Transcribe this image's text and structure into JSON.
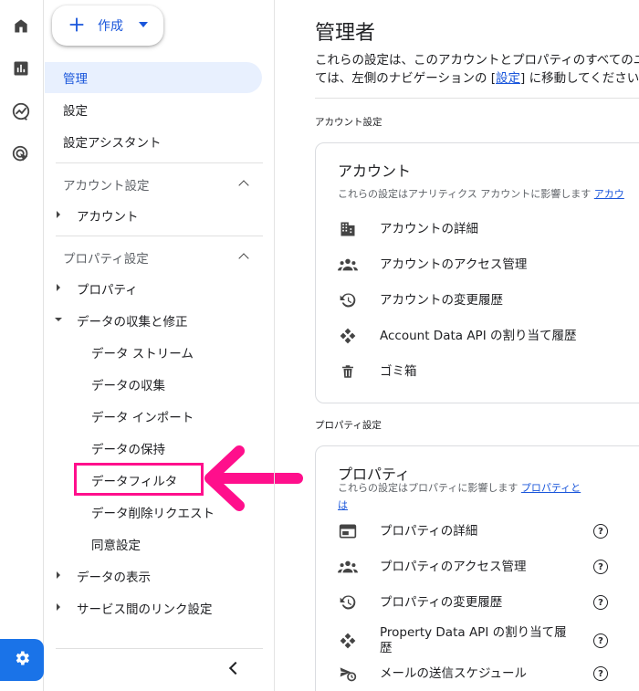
{
  "rail": {
    "icons": [
      "home-icon",
      "bar-chart-icon",
      "explore-icon",
      "advertising-icon"
    ],
    "settings_icon": "gear-icon",
    "accent": "#1a73e8"
  },
  "create_button": {
    "label": "作成"
  },
  "sidebar": {
    "admin": "管理",
    "settings": "設定",
    "setup_assistant": "設定アシスタント",
    "account_section": "アカウント設定",
    "account": "アカウント",
    "property_section": "プロパティ設定",
    "property": "プロパティ",
    "data_collection_group": "データの収集と修正",
    "sub_items": [
      "データ ストリーム",
      "データの収集",
      "データ インポート",
      "データの保持",
      "データフィルタ",
      "データ削除リクエスト",
      "同意設定"
    ],
    "data_display": "データの表示",
    "service_links": "サービス間のリンク設定",
    "highlight_color": "#ff0f8c"
  },
  "main": {
    "title": "管理者",
    "desc_line1": "これらの設定は、このアカウントとプロパティのすべてのユ",
    "desc_line2_pre": "ては、左側のナビゲーションの [",
    "desc_link": "設定",
    "desc_line2_post": "] に移動してください。",
    "account_label": "アカウント設定",
    "account_card": {
      "title": "アカウント",
      "subtitle": "これらの設定はアナリティクス アカウントに影響します",
      "subtitle_link": "アカウ",
      "rows": [
        {
          "icon": "building-icon",
          "label": "アカウントの詳細"
        },
        {
          "icon": "people-icon",
          "label": "アカウントのアクセス管理"
        },
        {
          "icon": "history-icon",
          "label": "アカウントの変更履歴"
        },
        {
          "icon": "api-icon",
          "label": "Account Data API の割り当て履歴"
        },
        {
          "icon": "trash-icon",
          "label": "ゴミ箱"
        }
      ]
    },
    "property_label": "プロパティ設定",
    "property_card": {
      "title": "プロパティ",
      "subtitle": "これらの設定はプロパティに影響します",
      "subtitle_link1": "プロパティと",
      "subtitle_link2": "は",
      "rows": [
        {
          "icon": "web-icon",
          "label": "プロパティの詳細"
        },
        {
          "icon": "people-icon",
          "label": "プロパティのアクセス管理"
        },
        {
          "icon": "history-icon",
          "label": "プロパティの変更履歴"
        },
        {
          "icon": "api-icon",
          "label": "Property Data API の割り当て履歴"
        },
        {
          "icon": "schedule-send-icon",
          "label": "メールの送信スケジュール"
        }
      ],
      "help_glyph": "?"
    }
  }
}
